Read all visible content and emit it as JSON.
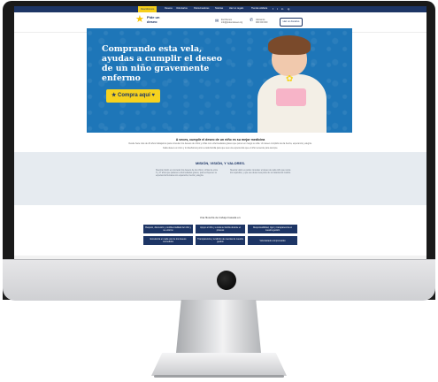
{
  "nav": {
    "items": [
      "Descúbrenos",
      "Deseos",
      "Voluntarios",
      "Patrocinadores",
      "Noticias",
      "Haz un regalo",
      "Tienda solidaria"
    ],
    "social": [
      "f",
      "t",
      "in",
      "ig",
      "yt"
    ]
  },
  "header": {
    "logo_line1": "Pide un",
    "logo_line2": "deseo",
    "email_label": "Escríbenos",
    "email_value": "info@pideundeseo.org",
    "phone_label": "Llámanos",
    "phone_value": "900 000 000",
    "donate_label": "Haz un donativo"
  },
  "hero": {
    "title": "Comprando esta vela, ayudas a cumplir el deseo de un niño gravemente enfermo",
    "button_label": "★ Compra aquí ♥"
  },
  "mission": {
    "title": "A veces, cumplir el deseo de un niño es su mejor medicina",
    "p1": "Desde hace más de 20 años trabajamos para conceder los deseos de niños y niñas con enfermedades graves que ponen en riesgo su vida. Un deseo cumplido les da fuerza, esperanza y alegría.",
    "p2": "Cada deseo es único y lo diseñamos junto a cada familia para que sea una experiencia que el niño recuerde para siempre."
  },
  "band": {
    "title": "MISIÓN, VISIÓN, Y VALORES.",
    "col1": "Nuestra misión es conceder los deseos de los niños y niñas de entre 3 y 17 años que padecen enfermedades graves, para enriquecer su experiencia humana con esperanza, fuerza y alegría.",
    "col2": "Nuestra visión es poder conceder el deseo de cada niño que reúna los requisitos, y que ese deseo sea parte de su tratamiento médico."
  },
  "values": {
    "title": "Una filosofía de trabajo basada en:",
    "items": [
      "Respeto, discreción y confidencialidad del niño y su entorno",
      "Apoyo al niño y a toda su familia durante el proceso",
      "Responsabilidad, rigor y transparencia en nuestra gestión",
      "Excelencia en cada uno de los deseos concedidos",
      "Transparencia y rendición de cuentas de nuestra gestión",
      "Voluntariado comprometido"
    ]
  },
  "colors": {
    "brand_navy": "#1d3565",
    "accent_yellow": "#f6d21f",
    "hero_blue": "#1e76b8"
  }
}
